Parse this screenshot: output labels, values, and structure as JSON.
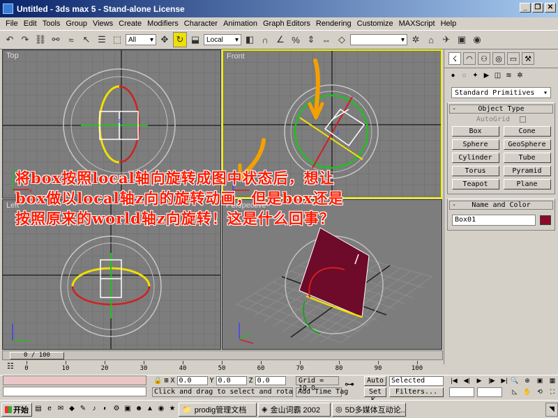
{
  "window": {
    "title": "Untitled - 3ds max 5 - Stand-alone License",
    "buttons": [
      "_",
      "❐",
      "✕"
    ]
  },
  "menu": [
    "File",
    "Edit",
    "Tools",
    "Group",
    "Views",
    "Create",
    "Modifiers",
    "Character",
    "Animation",
    "Graph Editors",
    "Rendering",
    "Customize",
    "MAXScript",
    "Help"
  ],
  "toolbar": {
    "selection_filter": "All",
    "coord_system": "Local",
    "named_selection": ""
  },
  "viewports": {
    "top": "Top",
    "front": "Front",
    "left": "Left",
    "perspective": "Perspective"
  },
  "overlay_text": [
    "将box按照local轴向旋转成图中状态后，想让",
    "box做以local轴z向的旋转动画，但是box还是",
    "按照原来的world轴z向旋转！这是什么回事？"
  ],
  "command_panel": {
    "dropdown": "Standard Primitives",
    "object_type_title": "Object Type",
    "autogrid_label": "AutoGrid",
    "objects": [
      "Box",
      "Cone",
      "Sphere",
      "GeoSphere",
      "Cylinder",
      "Tube",
      "Torus",
      "Pyramid",
      "Teapot",
      "Plane"
    ],
    "name_color_title": "Name and Color",
    "object_name": "Box01",
    "object_color": "#8b0a2a"
  },
  "time": {
    "slider_label": "0 / 100",
    "ticks": [
      0,
      10,
      20,
      30,
      40,
      50,
      60,
      70,
      80,
      90,
      100
    ]
  },
  "status": {
    "x_label": "X",
    "x_value": "0.0",
    "y_label": "Y",
    "y_value": "0.0",
    "z_label": "Z",
    "z_value": "0.0",
    "grid": "Grid = 10.0",
    "prompt": "Click and drag to select and rotate objects",
    "add_time_tag": "Add Time Tag",
    "auto_key": "Auto",
    "set_key": "Set K.",
    "selected": "Selected",
    "filters": "Filters..."
  },
  "taskbar": {
    "start": "开始",
    "tasks": [
      "prodig管理文档",
      "金山词霸 2002",
      "5D多媒体互动论..."
    ]
  }
}
